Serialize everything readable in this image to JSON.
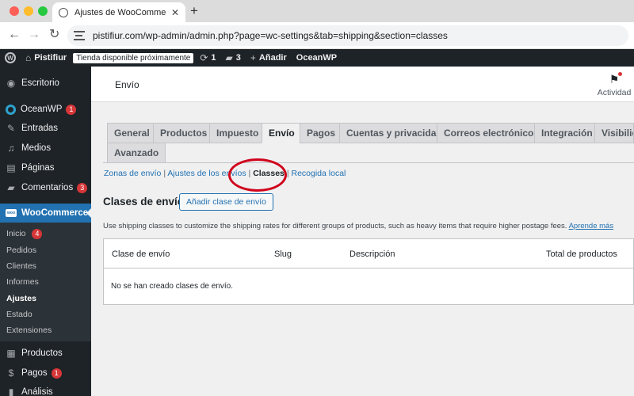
{
  "browser": {
    "tab_title": "Ajustes de WooCommerce ‹ P",
    "url": "pistifiur.com/wp-admin/admin.php?page=wc-settings&tab=shipping&section=classes"
  },
  "adminbar": {
    "site_name": "Pistifiur",
    "status_pill": "Tienda disponible próximamente",
    "updates_count": "1",
    "comments_count": "3",
    "add_new": "Añadir",
    "theme": "OceanWP"
  },
  "sidebar": {
    "items": [
      {
        "label": "Escritorio",
        "icon": "dashboard-icon"
      },
      {
        "label": "OceanWP",
        "badge": "1",
        "icon": "oceanwp-icon"
      },
      {
        "label": "Entradas",
        "icon": "pin-icon"
      },
      {
        "label": "Medios",
        "icon": "media-icon"
      },
      {
        "label": "Páginas",
        "icon": "pages-icon"
      },
      {
        "label": "Comentarios",
        "badge": "3",
        "icon": "comments-icon"
      },
      {
        "label": "WooCommerce",
        "icon": "woocommerce-icon"
      }
    ],
    "submenu": [
      {
        "label": "Inicio",
        "badge": "4"
      },
      {
        "label": "Pedidos"
      },
      {
        "label": "Clientes"
      },
      {
        "label": "Informes"
      },
      {
        "label": "Ajustes"
      },
      {
        "label": "Estado"
      },
      {
        "label": "Extensiones"
      }
    ],
    "bottom_items": [
      {
        "label": "Productos",
        "icon": "products-icon"
      },
      {
        "label": "Pagos",
        "badge": "1",
        "icon": "payments-icon"
      },
      {
        "label": "Análisis",
        "icon": "analytics-icon"
      }
    ]
  },
  "header": {
    "title": "Envío",
    "activity_label": "Actividad"
  },
  "tabs": [
    "General",
    "Productos",
    "Impuesto",
    "Envío",
    "Pagos",
    "Cuentas y privacidad",
    "Correos electrónicos",
    "Integración",
    "Visibilidad",
    "Avanzado"
  ],
  "active_tab": "Envío",
  "subnav": {
    "zones": "Zonas de envío",
    "options": "Ajustes de los envíos",
    "classes": "Classes",
    "local_pickup": "Recogida local"
  },
  "section": {
    "title": "Clases de envío",
    "add_button": "Añadir clase de envío",
    "description": "Use shipping classes to customize the shipping rates for different groups of products, such as heavy items that require higher postage fees.",
    "learn_more": "Aprende más"
  },
  "table": {
    "columns": [
      "Clase de envío",
      "Slug",
      "Descripción",
      "Total de productos"
    ],
    "empty_message": "No se han creado clases de envío."
  },
  "colors": {
    "admin_dark": "#1d2327",
    "accent_blue": "#2271b1",
    "badge_red": "#d63638",
    "highlight_circle": "#d0021b"
  }
}
